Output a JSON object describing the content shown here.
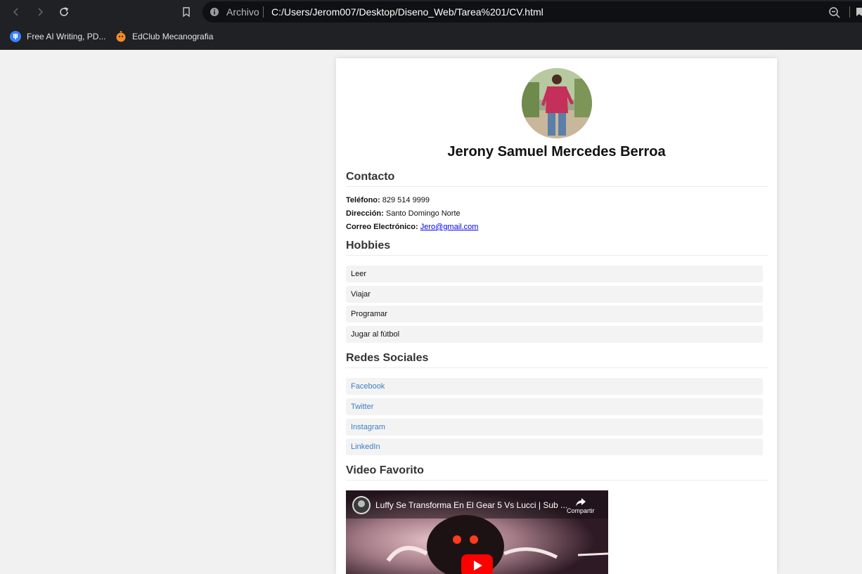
{
  "browser": {
    "scheme_label": "Archivo",
    "url": "C:/Users/Jerom007/Desktop/Diseno_Web/Tarea%201/CV.html",
    "bookmarks": [
      {
        "label": "Free AI Writing, PD...",
        "icon": "ai-writing-icon",
        "color": "#3b82f6"
      },
      {
        "label": "EdClub Mecanografia",
        "icon": "edclub-icon",
        "color": "#f28c28"
      }
    ]
  },
  "cv": {
    "name": "Jerony Samuel Mercedes Berroa",
    "contact": {
      "title": "Contacto",
      "phone_label": "Teléfono:",
      "phone": "829 514 9999",
      "address_label": "Dirección:",
      "address": "Santo Domingo Norte",
      "email_label": "Correo Electrónico:",
      "email": "Jero@gmail.com"
    },
    "hobbies": {
      "title": "Hobbies",
      "items": [
        "Leer",
        "Viajar",
        "Programar",
        "Jugar al fútbol"
      ]
    },
    "social": {
      "title": "Redes Sociales",
      "items": [
        "Facebook",
        "Twitter",
        "Instagram",
        "LinkedIn"
      ]
    },
    "video": {
      "title": "Video Favorito",
      "video_title": "Luffy Se Transforma En El Gear 5 Vs Lucci | Sub ...",
      "share_label": "Compartir"
    }
  },
  "colors": {
    "link": "#3a7fc4",
    "email_link": "#0000ee",
    "youtube_red": "#ff0000",
    "chrome_bg": "#1f2125"
  }
}
